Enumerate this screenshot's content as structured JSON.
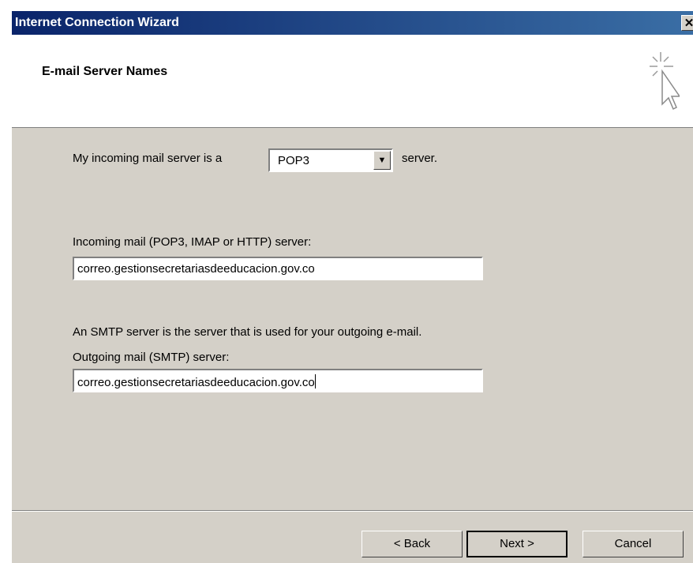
{
  "window": {
    "title": "Internet Connection Wizard",
    "close_label": "✕"
  },
  "header": {
    "title": "E-mail Server Names",
    "icon": "wizard-sparkle-cursor-icon"
  },
  "form": {
    "server_type_prefix": "My incoming mail server is a",
    "server_type_value": "POP3",
    "server_type_suffix": "server.",
    "incoming_label": "Incoming mail (POP3, IMAP or HTTP) server:",
    "incoming_value": "correo.gestionsecretariasdeeducacion.gov.co",
    "smtp_note": "An SMTP server is the server that is used for your outgoing e-mail.",
    "outgoing_label": "Outgoing mail (SMTP) server:",
    "outgoing_value": "correo.gestionsecretariasdeeducacion.gov.co"
  },
  "buttons": {
    "back": "< Back",
    "next": "Next >",
    "cancel": "Cancel"
  },
  "colors": {
    "title_gradient_start": "#0a246a",
    "title_gradient_end": "#3a6ea5",
    "dialog_face": "#d4d0c8"
  }
}
